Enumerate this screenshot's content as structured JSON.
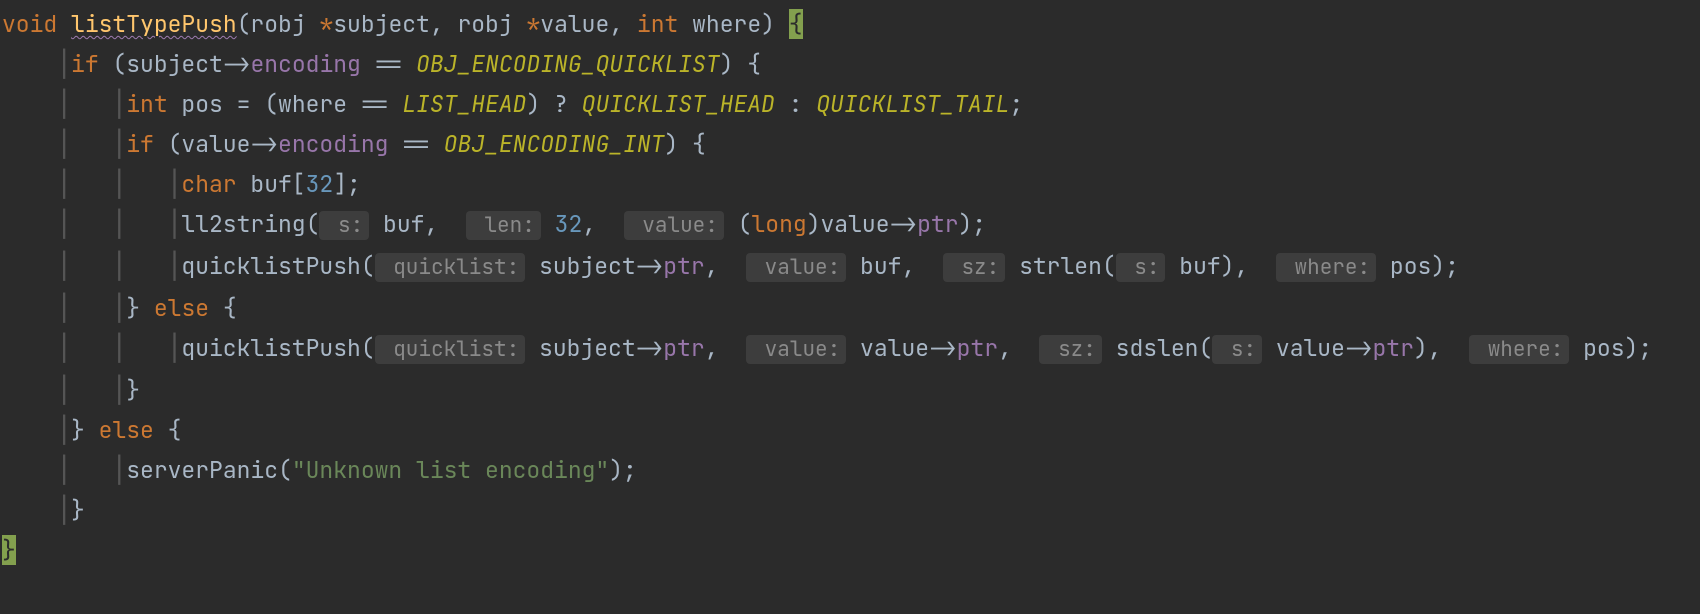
{
  "code": {
    "kw_void": "void",
    "fn_name": "listTypePush",
    "sig_open": "(robj ",
    "sig_star1": "*",
    "sig_p1": "subject",
    "sig_comma1": ", robj ",
    "sig_star2": "*",
    "sig_p2": "value",
    "sig_comma2": ", ",
    "kw_int": "int",
    "sig_p3": " where) ",
    "brace_open": "{",
    "kw_if1": "if",
    "if1_open": " (subject->",
    "fld_encoding": "encoding",
    "eqeq": " == ",
    "c_quicklistEnc": "OBJ_ENCODING_QUICKLIST",
    "if1_close": ") {",
    "kw_int2": "int",
    "decl_pos": " pos = (where == ",
    "c_listHead": "LIST_HEAD",
    "tern_q": ") ? ",
    "c_qlHead": "QUICKLIST_HEAD",
    "tern_colon": " : ",
    "c_qlTail": "QUICKLIST_TAIL",
    "semi": ";",
    "kw_if2": "if",
    "if2_open": " (value->",
    "c_intEnc": "OBJ_ENCODING_INT",
    "if2_close": ") {",
    "kw_char": "char",
    "buf_decl_open": " buf[",
    "n32": "32",
    "buf_decl_close": "];",
    "call_ll2string": "ll2string(",
    "hint_s": " s:",
    "arg_buf": " buf,  ",
    "hint_len": " len:",
    "arg_32": " 32",
    "comma_sp": ",  ",
    "hint_value": " value:",
    "cast_open": " (",
    "kw_long": "long",
    "cast_close": ")value->",
    "fld_ptr": "ptr",
    "call_close_semi": ");",
    "call_qlpush": "quicklistPush(",
    "hint_ql": " quicklist:",
    "arg_subj_ptr_open": " subject->",
    "arg_buf2": " buf,  ",
    "hint_sz": " sz:",
    "call_strlen": " strlen(",
    "arg_buf3": " buf),  ",
    "hint_where": " where:",
    "arg_pos": " pos);",
    "brace_close": "}",
    "kw_else": "else",
    "else_open": " {",
    "arg_val_ptr_open": " value->",
    "call_sdslen": " sdslen(",
    "arg_valptr_close": "),  ",
    "call_panic": "serverPanic(",
    "str_unknown": "\"Unknown list encoding\"",
    "call_panic_close": ");",
    "caret_brace": "}"
  }
}
